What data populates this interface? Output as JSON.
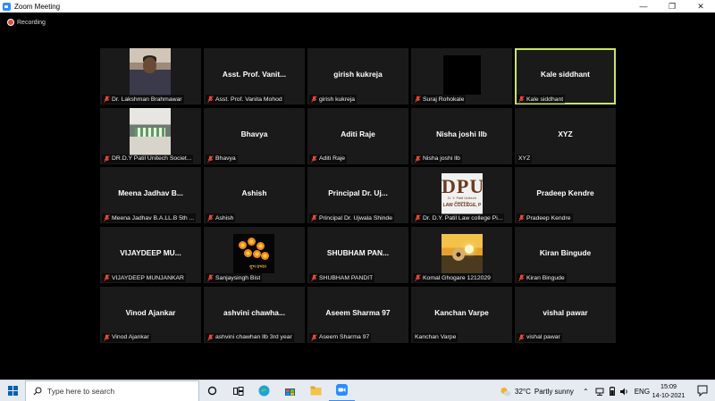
{
  "window": {
    "title": "Zoom Meeting"
  },
  "recording": {
    "label": "Recording"
  },
  "participants": [
    {
      "display": "",
      "label": "Dr. Lakshman Brahmawar",
      "muted": true,
      "photo": "lakshman"
    },
    {
      "display": "Asst. Prof. Vanit...",
      "label": "Asst. Prof. Vanita Mohod",
      "muted": true
    },
    {
      "display": "girish kukreja",
      "label": "girish kukreja",
      "muted": true
    },
    {
      "display": "",
      "label": "Suraj Rohokale",
      "muted": true,
      "photo": "suraj"
    },
    {
      "display": "Kale siddhant",
      "label": "Kale siddhant",
      "muted": true,
      "active": true
    },
    {
      "display": "",
      "label": "DR.D.Y Patil Unitech Societ...",
      "muted": true,
      "photo": "dy"
    },
    {
      "display": "Bhavya",
      "label": "Bhavya",
      "muted": true
    },
    {
      "display": "Aditi Raje",
      "label": "Aditi Raje",
      "muted": true
    },
    {
      "display": "Nisha joshi llb",
      "label": "Nisha joshi llb",
      "muted": true
    },
    {
      "display": "XYZ",
      "label": "XYZ",
      "muted": false
    },
    {
      "display": "Meena Jadhav B...",
      "label": "Meena Jadhav B.A.LL.B 5th ...",
      "muted": true
    },
    {
      "display": "Ashish",
      "label": "Ashish",
      "muted": true
    },
    {
      "display": "Principal  Dr. Uj...",
      "label": "Principal Dr. Ujwala Shinde",
      "muted": true
    },
    {
      "display": "",
      "label": "Dr. D.Y. Patil Law college Pi...",
      "muted": true,
      "photo": "logo"
    },
    {
      "display": "Pradeep Kendre",
      "label": "Pradeep Kendre",
      "muted": true
    },
    {
      "display": "VIJAYDEEP  MU...",
      "label": "VIJAYDEEP MUNJANKAR",
      "muted": true
    },
    {
      "display": "",
      "label": "Sanjaysingh Bist",
      "muted": true,
      "photo": "flowers"
    },
    {
      "display": "SHUBHAM  PAN...",
      "label": "SHUBHAM PANDIT",
      "muted": true
    },
    {
      "display": "",
      "label": "Komal Ghogare 1212029",
      "muted": true,
      "photo": "sunset"
    },
    {
      "display": "Kiran Bingude",
      "label": "Kiran Bingude",
      "muted": true
    },
    {
      "display": "Vinod Ajankar",
      "label": "Vinod Ajankar",
      "muted": true
    },
    {
      "display": "ashvini  chawha...",
      "label": "ashvini chawhan llb 3rd year",
      "muted": true
    },
    {
      "display": "Aseem Sharma 97",
      "label": "Aseem Sharma 97",
      "muted": true
    },
    {
      "display": "Kanchan Varpe",
      "label": "Kanchan Varpe",
      "muted": false
    },
    {
      "display": "vishal pawar",
      "label": "vishal pawar",
      "muted": true
    }
  ],
  "photos": {
    "logo": {
      "big": "DPU",
      "line1": "D. Y. Patil Unitech Society's",
      "line2": "LAW COLLEGE, P"
    },
    "flowers": {
      "caption": "शुभ प्रभात"
    }
  },
  "taskbar": {
    "search_placeholder": "Type here to search",
    "weather_temp": "32°C",
    "weather_cond": "Partly sunny",
    "lang": "ENG",
    "time": "15:09",
    "date": "14-10-2021"
  },
  "colors": {
    "active_border": "#c8e66b",
    "muted_icon": "#e5493a",
    "tile_bg": "#1a1a1a"
  }
}
